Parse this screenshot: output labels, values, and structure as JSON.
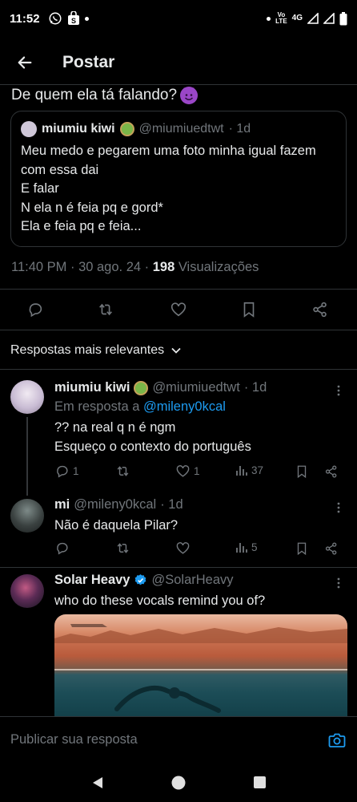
{
  "status_bar": {
    "time": "11:52",
    "icons": [
      "whatsapp-icon",
      "shopping-bag-icon",
      "notification-dot"
    ],
    "right_icons": [
      "dot-icon",
      "volte-icon",
      "4g-icon",
      "signal-icon",
      "signal-icon",
      "battery-icon"
    ],
    "volte_top": "Vo",
    "volte_bottom": "LTE",
    "network": "4G"
  },
  "header": {
    "title": "Postar",
    "back_icon": "arrow-left-icon"
  },
  "main_post": {
    "text": "De quem ela tá falando?",
    "emoji": "smiling-devil-emoji",
    "quote": {
      "name": "miumiu kiwi",
      "handle": "@miumiuedtwt",
      "time": "· 1d",
      "lines": [
        "Meu medo e pegarem uma foto minha igual fazem",
        "com essa dai",
        "E falar",
        "N ela n é feia pq e gord*",
        "Ela e feia pq e feia..."
      ]
    },
    "meta": {
      "timestamp": "11:40 PM · 30 ago. 24 · ",
      "views_count": "198",
      "views_label": " Visualizações"
    },
    "actions": [
      "reply-icon",
      "retweet-icon",
      "like-icon",
      "bookmark-icon",
      "share-icon"
    ]
  },
  "sort": {
    "label": "Respostas mais relevantes"
  },
  "replies": [
    {
      "name": "miumiu kiwi",
      "handle": "@miumiuedtwt",
      "time": "· 1d",
      "reply_to_prefix": "Em resposta a ",
      "reply_to_handle": "@mileny0kcal",
      "lines": [
        "?? na real q n é ngm",
        "Esqueço o contexto do português"
      ],
      "counts": {
        "replies": "1",
        "retweets": "",
        "likes": "1",
        "views": "37"
      }
    },
    {
      "name": "mi",
      "handle": "@mileny0kcal",
      "time": "· 1d",
      "lines": [
        "Não é daquela Pilar?"
      ],
      "counts": {
        "replies": "",
        "retweets": "",
        "likes": "",
        "views": "5"
      }
    },
    {
      "name": "Solar Heavy",
      "handle": "@SolarHeavy",
      "lines": [
        "who do these vocals remind you of?"
      ],
      "verified": true
    }
  ],
  "reply_bar": {
    "placeholder": "Publicar sua resposta",
    "icon": "camera-icon"
  },
  "nav_bar": {
    "icons": [
      "back-triangle-icon",
      "home-circle-icon",
      "recents-square-icon"
    ]
  },
  "colors": {
    "background": "#000000",
    "text": "#e7e9ea",
    "muted": "#71767b",
    "accent": "#1d9bf0",
    "border": "#2f3336"
  }
}
